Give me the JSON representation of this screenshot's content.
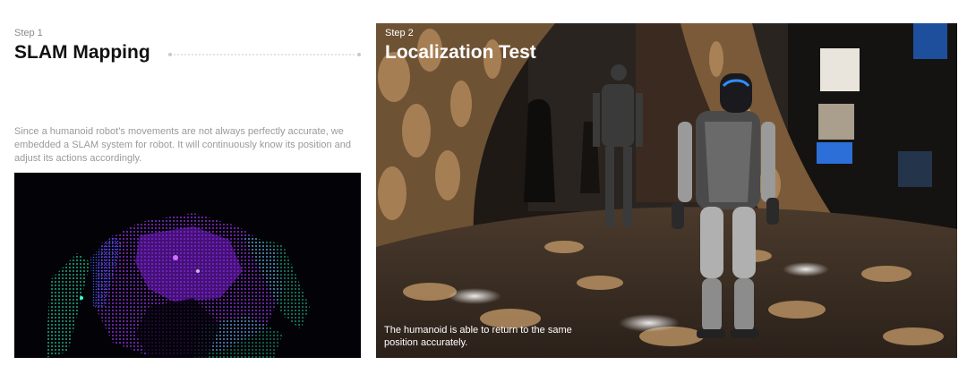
{
  "left": {
    "step": "Step 1",
    "title": "SLAM Mapping",
    "description": "Since a humanoid robot’s movements are not always perfectly accurate, we embedded a SLAM system for robot. It will continuously know its position and adjust its actions accordingly."
  },
  "right": {
    "step": "Step 2",
    "title": "Localization Test",
    "caption": "The humanoid is able to return to the same position accurately."
  },
  "colors": {
    "slam_background": "#030207",
    "slam_primary": "#8a2be2",
    "slam_secondary": "#19c6a8",
    "robot_visor": "#2f8dff"
  }
}
